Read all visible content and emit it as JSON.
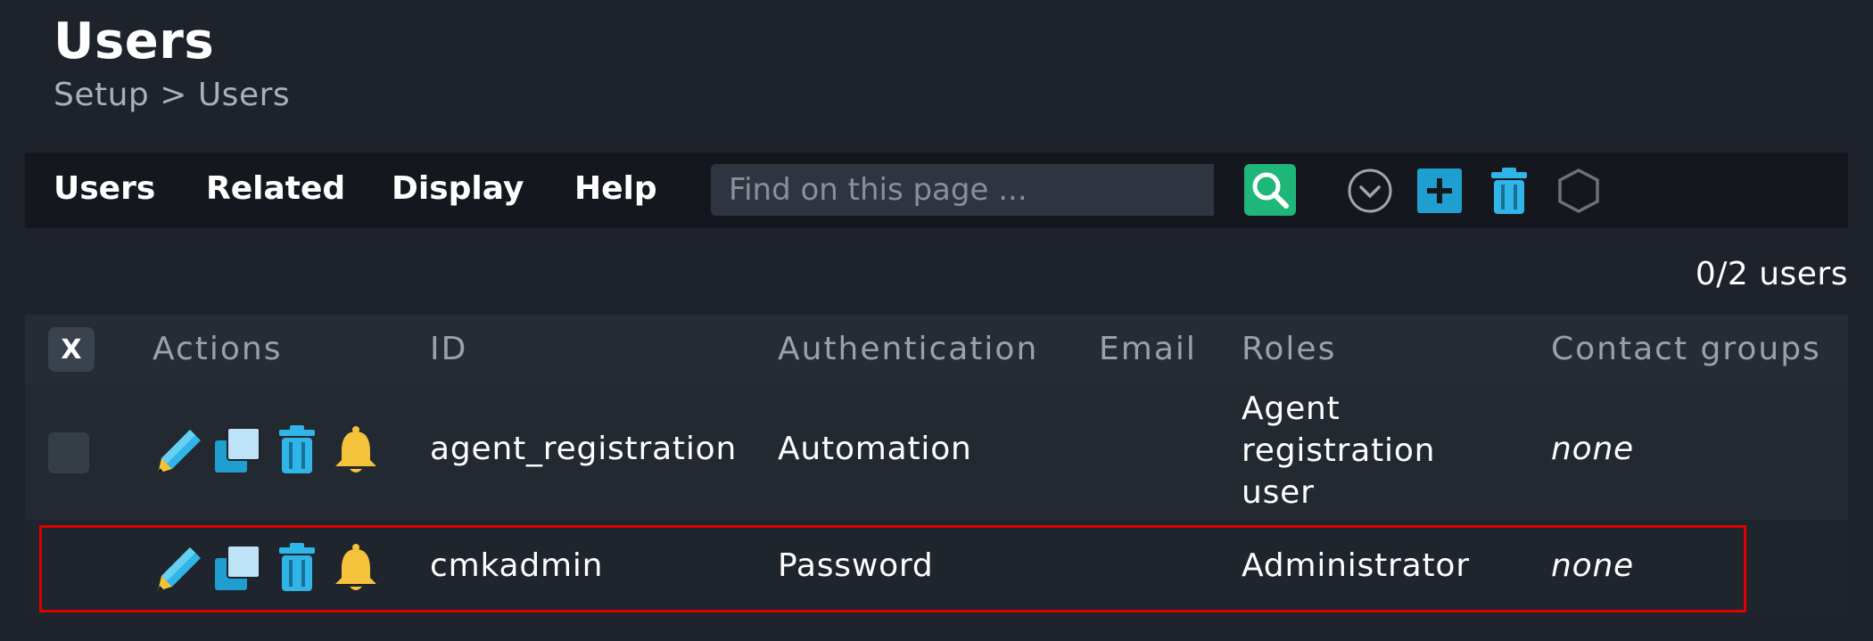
{
  "page": {
    "title": "Users",
    "breadcrumb": "Setup > Users"
  },
  "menu": {
    "items": [
      "Users",
      "Related",
      "Display",
      "Help"
    ]
  },
  "search": {
    "placeholder": "Find on this page ..."
  },
  "toolbar": {
    "icons": [
      "search-icon",
      "chevron-down-icon",
      "add-icon",
      "trash-icon",
      "hexagon-icon"
    ]
  },
  "summary": {
    "count": "0/2 users"
  },
  "table": {
    "select_all_label": "X",
    "columns": [
      "Actions",
      "ID",
      "Authentication",
      "Email",
      "Roles",
      "Contact groups"
    ],
    "rows": [
      {
        "id": "agent_registration",
        "authentication": "Automation",
        "email": "",
        "roles": "Agent registration user",
        "contact_groups": "none"
      },
      {
        "id": "cmkadmin",
        "authentication": "Password",
        "email": "",
        "roles": "Administrator",
        "contact_groups": "none"
      }
    ],
    "action_icons": [
      "pencil-icon",
      "clone-icon",
      "trash-icon",
      "bell-icon"
    ]
  },
  "colors": {
    "background": "#1e232b",
    "accent_green": "#1fb67a",
    "accent_blue": "#1e9fd0",
    "bell_yellow": "#f5c23c",
    "highlight_red": "#e00000"
  }
}
